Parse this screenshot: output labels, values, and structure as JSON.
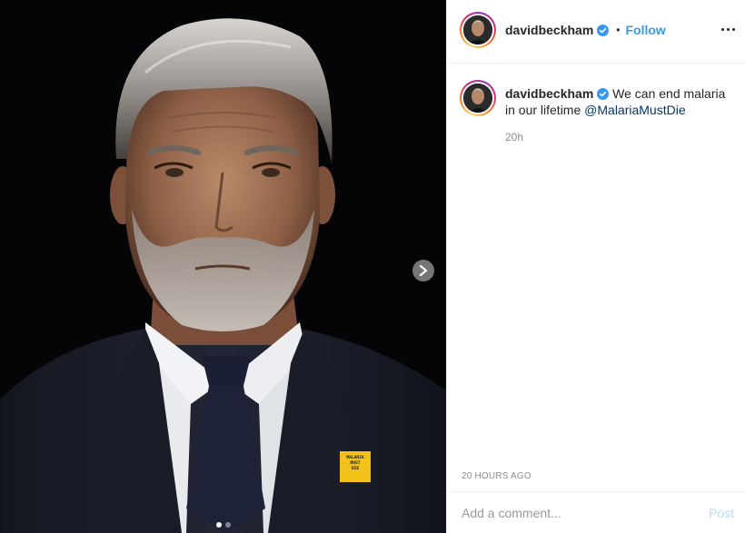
{
  "post": {
    "username": "davidbeckham",
    "verified": true,
    "separator": "•",
    "follow_label": "Follow",
    "more_icon": "more-options-icon",
    "caption_text": "We can end malaria in our lifetime",
    "caption_mention": "@MalariaMustDie",
    "time_short": "20h",
    "time_long": "20 HOURS AGO",
    "comment": {
      "placeholder": "Add a comment...",
      "value": ""
    },
    "post_label": "Post"
  },
  "media": {
    "pin_text": [
      "MALARIA",
      "MUST",
      "DIE"
    ],
    "carousel": {
      "count": 2,
      "active": 1
    },
    "next_icon": "chevron-right-icon"
  },
  "colors": {
    "link": "#3897f0",
    "mention": "#003569",
    "verified": "#3897f0",
    "pin": "#f2c21a"
  }
}
